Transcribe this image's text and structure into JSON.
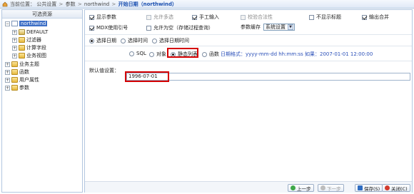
{
  "breadcrumb": {
    "items": [
      "当前位置：",
      "公共设置",
      ">",
      "参数",
      ">",
      "northwind",
      ">"
    ],
    "current": "开始日期（northwind）"
  },
  "sidebar": {
    "title": "可选资源",
    "root": "northwind",
    "children": [
      "DEFAULT",
      "过滤器",
      "计算字段",
      "业务视图"
    ],
    "top_level": [
      "业务主题",
      "函数",
      "用户属性",
      "参数"
    ]
  },
  "options": {
    "row1": [
      {
        "label": "显示参数",
        "checked": true,
        "disabled": false
      },
      {
        "label": "允许多选",
        "checked": false,
        "disabled": true
      },
      {
        "label": "手工输入",
        "checked": true,
        "disabled": false
      },
      {
        "label": "校验合法性",
        "checked": false,
        "disabled": true
      },
      {
        "label": "不显示标题",
        "checked": false,
        "disabled": false
      },
      {
        "label": "输出合并",
        "checked": true,
        "disabled": false
      }
    ],
    "row2": [
      {
        "label": "MDX使用引号",
        "checked": true,
        "disabled": false
      },
      {
        "label": "允许为空（存储过程查询）",
        "checked": false,
        "disabled": false
      }
    ],
    "cache_label": "参数缓存",
    "cache_value": "系统设置"
  },
  "mode": {
    "options": [
      "选择日期",
      "选择时间",
      "选择日期时间"
    ],
    "selected": 0
  },
  "source": {
    "options": [
      "SQL",
      "对象",
      "静态列表",
      "函数"
    ],
    "selected": 2,
    "format_text": "日期格式：yyyy-mm-dd hh:mm:ss 如果：2007-01-01 12:00:00"
  },
  "default": {
    "label": "默认值设置：",
    "value": "1996-07-01"
  },
  "buttons": {
    "prev": "上一步",
    "next": "下一步",
    "save": "保存(S)",
    "close": "关闭(C)"
  },
  "colors": {
    "accent": "#1a4fb0",
    "highlight": "#d40000"
  }
}
